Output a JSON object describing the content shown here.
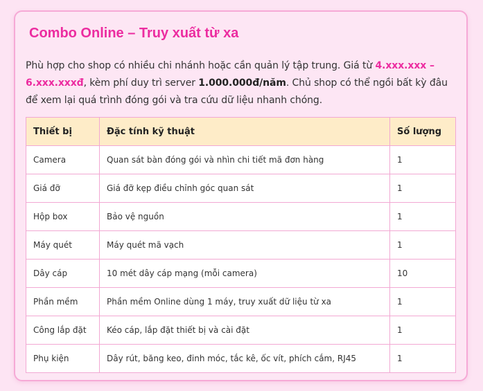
{
  "section": {
    "title": "Combo Online – Truy xuất từ xa",
    "description": {
      "part1": "Phù hợp cho shop có nhiều chi nhánh hoặc cần quản lý tập trung. Giá từ ",
      "price_range": "4.xxx.xxx – 6.xxx.xxxđ",
      "part2": ", kèm phí duy trì server ",
      "server_fee": "1.000.000đ/năm",
      "part3": ". Chủ shop có thể ngồi bất kỳ đâu để xem lại quá trình đóng gói và tra cứu dữ liệu nhanh chóng."
    }
  },
  "table": {
    "headers": [
      "Thiết bị",
      "Đặc tính kỹ thuật",
      "Số lượng"
    ],
    "rows": [
      {
        "device": "Camera",
        "spec": "Quan sát bàn đóng gói và nhìn chi tiết mã đơn hàng",
        "qty": "1"
      },
      {
        "device": "Giá đỡ",
        "spec": "Giá đỡ kẹp điều chỉnh góc quan sát",
        "qty": "1"
      },
      {
        "device": "Hộp box",
        "spec": "Bảo vệ nguồn",
        "qty": "1"
      },
      {
        "device": "Máy quét",
        "spec": "Máy quét mã vạch",
        "qty": "1"
      },
      {
        "device": "Dây cáp",
        "spec": "10 mét dây cáp mạng (mỗi camera)",
        "qty": "10"
      },
      {
        "device": "Phần mềm",
        "spec": "Phần mềm Online dùng 1 máy, truy xuất dữ liệu từ xa",
        "qty": "1"
      },
      {
        "device": "Công lắp đặt",
        "spec": "Kéo cáp, lắp đặt thiết bị và cài đặt",
        "qty": "1"
      },
      {
        "device": "Phụ kiện",
        "spec": "Dây rút, băng keo, đinh móc, tắc kê, ốc vít, phích cắm, RJ45",
        "qty": "1"
      }
    ]
  }
}
